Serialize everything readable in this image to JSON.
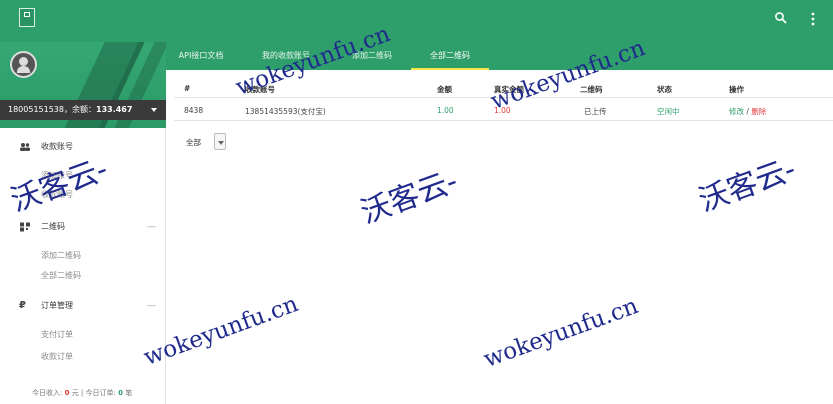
{
  "sidebar": {
    "user_text": "18005151538，余额：",
    "balance": "133.467",
    "groups": [
      {
        "title": "收款账号",
        "icon": "users-icon",
        "items": [
          "添加账号",
          "收款账号"
        ]
      },
      {
        "title": "二维码",
        "icon": "qrcode-icon",
        "items": [
          "添加二维码",
          "全部二维码"
        ]
      },
      {
        "title": "订单管理",
        "icon": "currency-icon",
        "items": [
          "支付订单",
          "收款订单"
        ]
      }
    ],
    "footer": {
      "income_label": "今日收入:",
      "income_value": "0",
      "income_unit": "元 | 今日订单:",
      "orders_value": "0",
      "orders_unit": "笔"
    }
  },
  "tabs": [
    "API接口文档",
    "我的收款账号",
    "添加二维码",
    "全部二维码"
  ],
  "active_tab": "全部二维码",
  "table": {
    "headers": [
      "#",
      "收款账号",
      "金额",
      "真实金额",
      "二维码",
      "状态",
      "操作"
    ],
    "rows": [
      {
        "id": "8438",
        "account": "13851435593(支付宝)",
        "amount": "1.00",
        "real_amount": "1.00",
        "qrcode": "已上传",
        "status": "空闲中",
        "action_edit": "修改",
        "action_sep": " / ",
        "action_delete": "删除"
      }
    ]
  },
  "filter": {
    "selected": "全部"
  },
  "watermark": {
    "cn": "沃客云-",
    "en": "wokeyunfu.cn"
  },
  "colors": {
    "brand_green": "#2e9e6a",
    "accent_red": "#e03b3b",
    "tab_underline": "#f2e84b",
    "watermark": "#1f2a8c"
  }
}
